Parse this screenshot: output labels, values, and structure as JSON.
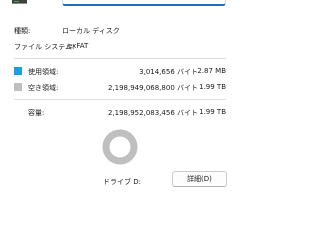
{
  "header": {
    "drive_icon": "drive-icon",
    "name_value": ""
  },
  "info": {
    "type_label": "種類:",
    "type_value": "ローカル ディスク",
    "fs_label": "ファイル システム:",
    "fs_value": "exFAT"
  },
  "usage": {
    "used": {
      "label": "使用領域:",
      "bytes": "3,014,656 バイト",
      "size": "2.87 MB",
      "color": "#1ba1e2"
    },
    "free": {
      "label": "空き領域:",
      "bytes": "2,198,949,068,800 バイト",
      "size": "1.99 TB",
      "color": "#bfbfbf"
    },
    "capacity": {
      "label": "容量:",
      "bytes": "2,198,952,083,456 バイト",
      "size": "1.99 TB"
    },
    "used_fraction": 1.4e-06
  },
  "drive": {
    "caption": "ドライブ D:",
    "details_label": "詳細(D)"
  }
}
